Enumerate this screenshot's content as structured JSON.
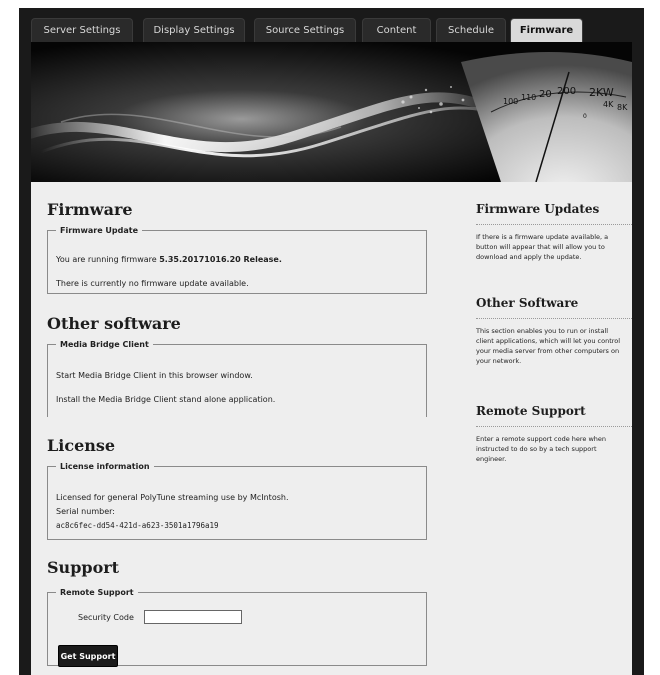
{
  "tabs": [
    {
      "label": "Server Settings",
      "active": false
    },
    {
      "label": "Display Settings",
      "active": false
    },
    {
      "label": "Source Settings",
      "active": false
    },
    {
      "label": "Content",
      "active": false
    },
    {
      "label": "Schedule",
      "active": false
    },
    {
      "label": "Firmware",
      "active": true
    }
  ],
  "banner": {
    "meter_labels": [
      "100",
      "110",
      "20",
      "200",
      "2KW",
      "4K",
      "8K",
      "0"
    ]
  },
  "sections": {
    "firmware": {
      "title": "Firmware",
      "fieldset_legend": "Firmware Update",
      "running_text": "You are running firmware",
      "version": "5.35.20171016.20 Release.",
      "update_status": "There is currently no firmware update available."
    },
    "other_software": {
      "title": "Other software",
      "fieldset_legend": "Media Bridge Client",
      "option_browser": "Start Media Bridge Client in this browser window.",
      "option_standalone": "Install the Media Bridge Client stand alone application."
    },
    "license": {
      "title": "License",
      "fieldset_legend": "License information",
      "license_text": "Licensed for general PolyTune streaming use by McIntosh.",
      "serial_label": "Serial number:",
      "serial_value": "ac8c6fec-dd54-421d-a623-3501a1796a19"
    },
    "support": {
      "title": "Support",
      "fieldset_legend": "Remote Support",
      "security_code_label": "Security Code",
      "security_code_value": "",
      "button_label": "Get Support"
    }
  },
  "sidebar": {
    "firmware_updates": {
      "title": "Firmware Updates",
      "text": "If there is a firmware update available, a button will appear that will allow you to download and apply the update."
    },
    "other_software": {
      "title": "Other Software",
      "text": "This section enables you to run or install client applications, which will let you control your media server from other computers on your network."
    },
    "remote_support": {
      "title": "Remote Support",
      "text": "Enter a remote support code here when instructed to do so by a tech support engineer."
    }
  }
}
